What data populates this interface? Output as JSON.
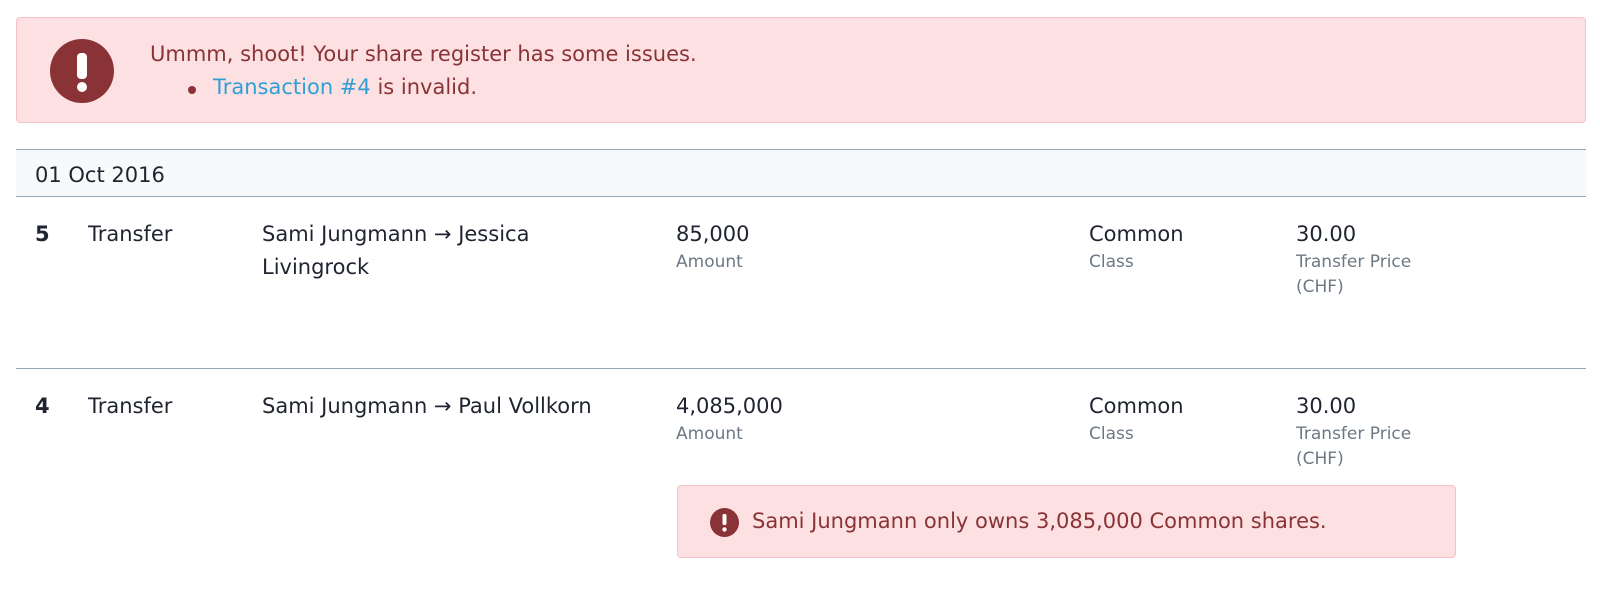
{
  "alert": {
    "title": "Ummm, shoot! Your share register has some issues.",
    "items": [
      {
        "link_text": "Transaction #4",
        "suffix": " is invalid."
      }
    ]
  },
  "date_group": {
    "date": "01 Oct 2016"
  },
  "transactions": [
    {
      "number": "5",
      "type": "Transfer",
      "parties": "Sami Jungmann → Jessica Livingrock",
      "amount": "85,000",
      "amount_label": "Amount",
      "class": "Common",
      "class_label": "Class",
      "price": "30.00",
      "price_label": "Transfer Price (CHF)"
    },
    {
      "number": "4",
      "type": "Transfer",
      "parties": "Sami Jungmann → Paul Vollkorn",
      "amount": "4,085,000",
      "amount_label": "Amount",
      "class": "Common",
      "class_label": "Class",
      "price": "30.00",
      "price_label": "Transfer Price (CHF)",
      "error": "Sami Jungmann only owns 3,085,000 Common shares."
    }
  ],
  "colors": {
    "error_bg": "#fde0e1",
    "error_text": "#8a3336",
    "link": "#2fa0d6",
    "divider": "#9aa7b5"
  },
  "icons": {
    "alert": "exclamation-circle-icon"
  }
}
